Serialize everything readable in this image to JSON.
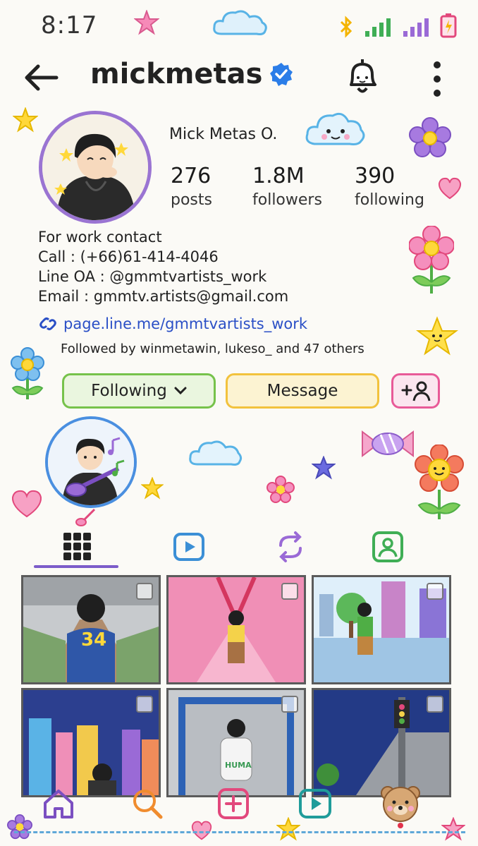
{
  "status_bar": {
    "time": "8:17"
  },
  "header": {
    "username": "mickmetas"
  },
  "profile": {
    "full_name": "Mick Metas O.",
    "stats": [
      {
        "value": "276",
        "label": "posts"
      },
      {
        "value": "1.8M",
        "label": "followers"
      },
      {
        "value": "390",
        "label": "following"
      }
    ],
    "bio": [
      "For work contact",
      "Call : (+66)61-414-4046",
      "Line OA : @gmmtvartists_work",
      "Email : gmmtv.artists@gmail.com"
    ],
    "link": "page.line.me/gmmtvartists_work",
    "followed_by": "Followed by winmetawin, lukeso_ and 47 others"
  },
  "actions": {
    "following_label": "Following",
    "message_label": "Message"
  },
  "photo_numbers": {
    "jersey": "34",
    "sweater": "HUMA"
  },
  "colors": {
    "accent_purple": "#7c5cc9",
    "following_green": "#76c24b",
    "message_yellow": "#f2c23d",
    "add_pink": "#e85a98",
    "link_blue": "#2a4fc6",
    "verified_blue": "#2b7de8"
  },
  "tabs": [
    {
      "icon": "grid-icon",
      "active": true
    },
    {
      "icon": "reels-icon",
      "active": false
    },
    {
      "icon": "repost-icon",
      "active": false
    },
    {
      "icon": "tagged-icon",
      "active": false
    }
  ],
  "nav": [
    "home-icon",
    "search-icon",
    "create-icon",
    "reels-icon",
    "profile-bear-icon"
  ]
}
